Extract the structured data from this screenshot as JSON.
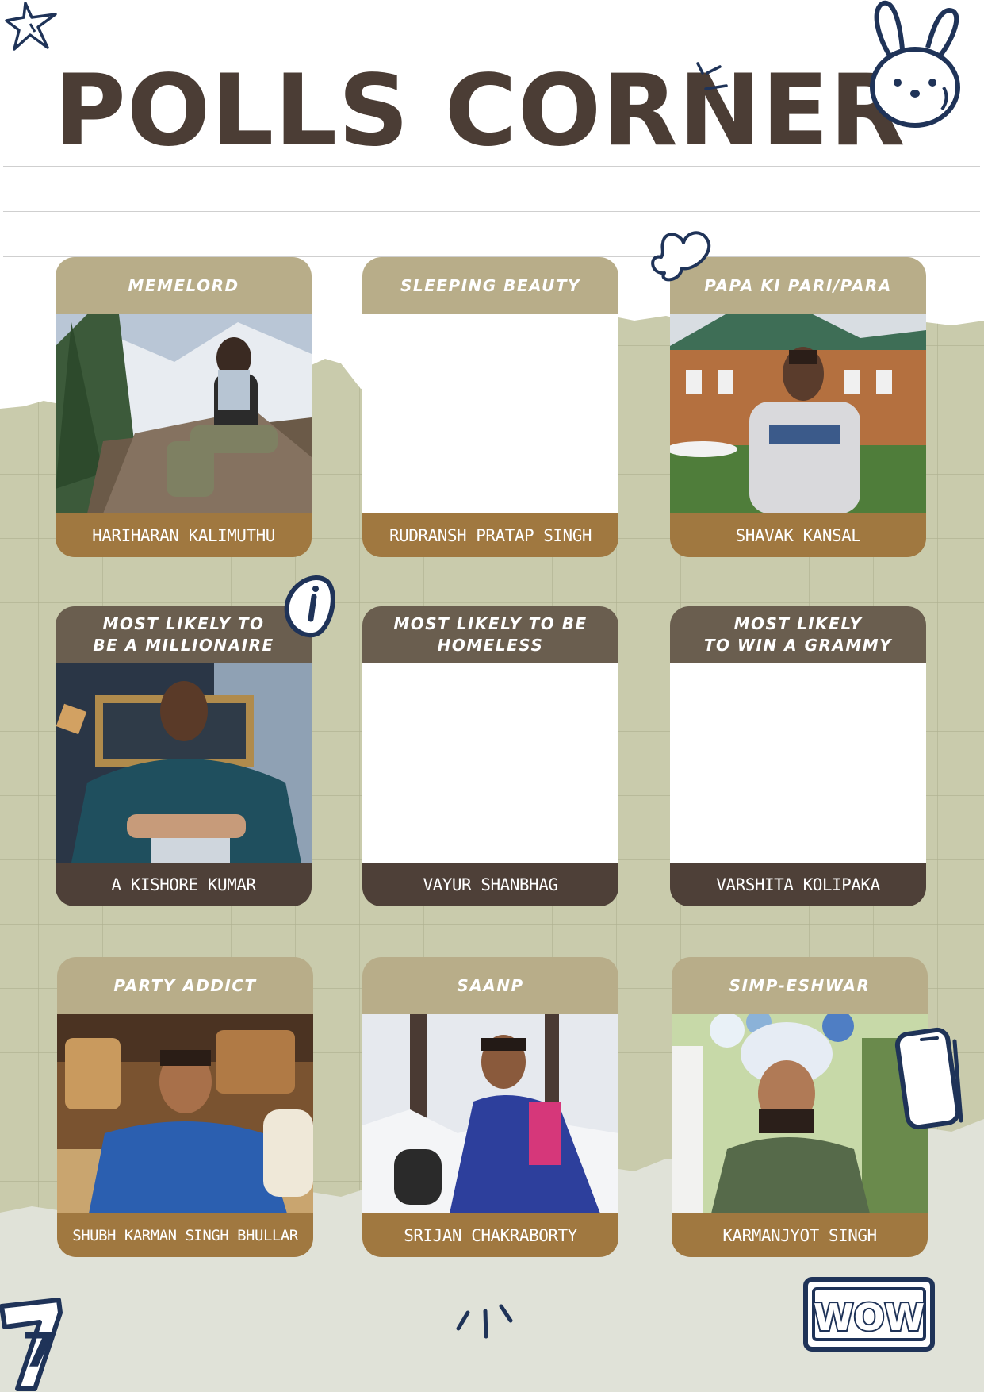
{
  "page": {
    "title": "POLLS CORNER"
  },
  "colors": {
    "title": "#4b3d35",
    "grid_green": "#c9cbac",
    "bottom_paper": "#e0e2d8",
    "card_tan_header": "#b8ad89",
    "card_tan_footer": "#a07840",
    "card_dark_header": "#6a5e4f",
    "card_dark_footer": "#4e4038",
    "doodle_navy": "#1f3358"
  },
  "cards": [
    {
      "award": "MEMELORD",
      "name": "HARIHARAN KALIMUTHU",
      "photo": "person-sitting-on-rock-mountains"
    },
    {
      "award": "SLEEPING BEAUTY",
      "name": "RUDRANSH PRATAP SINGH",
      "photo": "blank"
    },
    {
      "award": "PAPA KI PARI/PARA",
      "name": "SHAVAK KANSAL",
      "photo": "person-in-front-of-building"
    },
    {
      "award": "MOST LIKELY TO\nBE A MILLIONAIRE",
      "name": "A KISHORE KUMAR",
      "photo": "person-in-chair"
    },
    {
      "award": "MOST LIKELY TO BE\nHOMELESS",
      "name": "VAYUR SHANBHAG",
      "photo": "blank"
    },
    {
      "award": "MOST LIKELY\nTO WIN A GRAMMY",
      "name": "VARSHITA KOLIPAKA",
      "photo": "blank"
    },
    {
      "award": "PARTY ADDICT",
      "name": "SHUBH KARMAN SINGH BHULLAR",
      "photo": "person-at-cafe"
    },
    {
      "award": "SAANP",
      "name": "SRIJAN CHAKRABORTY",
      "photo": "person-in-snow"
    },
    {
      "award": "SIMP-ESHWAR",
      "name": "KARMANJYOT SINGH",
      "photo": "person-in-turban"
    }
  ],
  "doodles": {
    "wow_sticker": "WOW",
    "number_sticker": "7",
    "icons": [
      "star-icon",
      "bunny-icon",
      "sparkle-icon",
      "heart-icon",
      "info-icon",
      "phone-icon",
      "sparkle-icon"
    ]
  }
}
